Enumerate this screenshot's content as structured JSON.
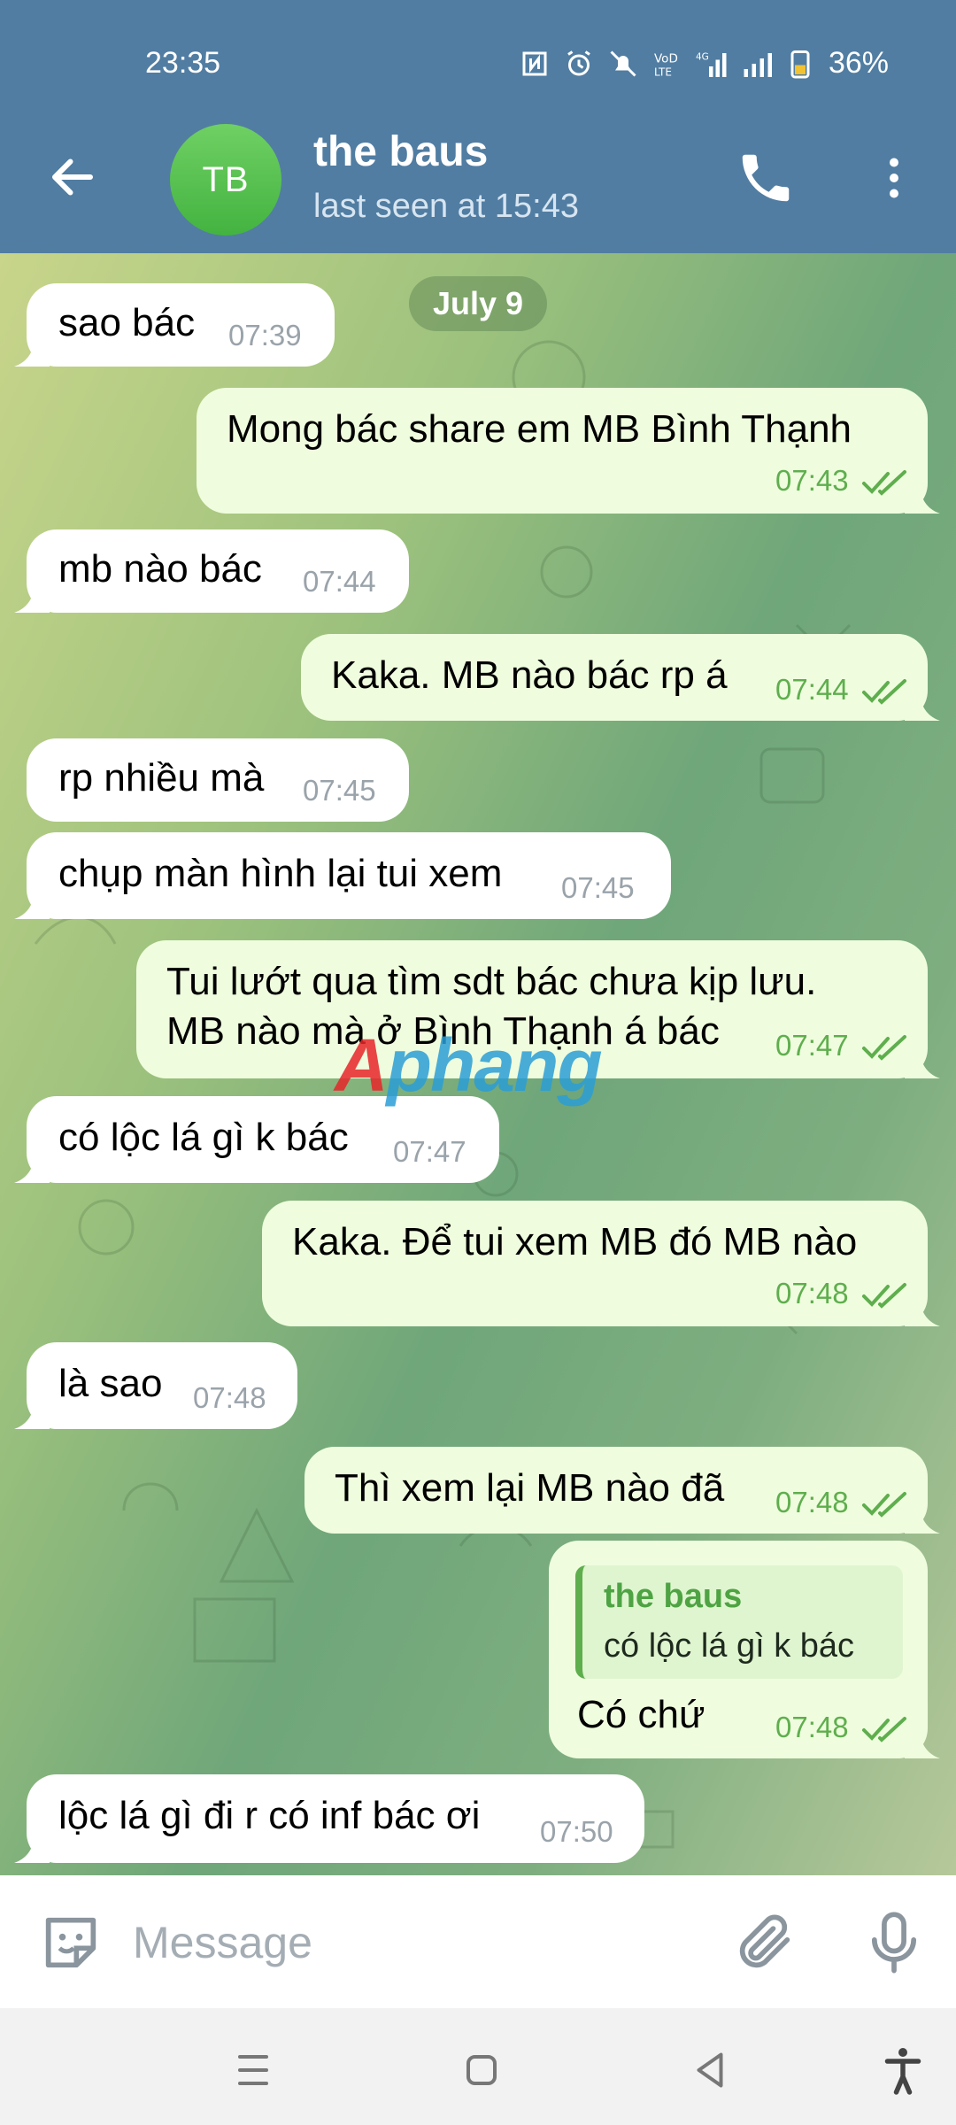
{
  "status_bar": {
    "time": "23:35",
    "battery": "36%"
  },
  "header": {
    "avatar_initials": "TB",
    "name": "the baus",
    "last_seen": "last seen at 15:43"
  },
  "date_separator": "July 9",
  "messages": [
    {
      "dir": "in",
      "text": "sao bác",
      "time": "07:39"
    },
    {
      "dir": "out",
      "text": "Mong bác share em MB Bình Thạnh",
      "time": "07:43"
    },
    {
      "dir": "in",
      "text": "mb nào bác",
      "time": "07:44"
    },
    {
      "dir": "out",
      "text": "Kaka. MB nào bác rp á",
      "time": "07:44"
    },
    {
      "dir": "in",
      "text": "rp nhiều mà",
      "time": "07:45"
    },
    {
      "dir": "in",
      "text": "chụp màn hình lại tui xem",
      "time": "07:45"
    },
    {
      "dir": "out",
      "text_line1": "Tui lướt qua tìm sdt bác chưa kịp lưu.",
      "text_line2": "MB nào mà ở Bình Thạnh á bác",
      "time": "07:47"
    },
    {
      "dir": "in",
      "text": "có lộc lá gì k bác",
      "time": "07:47"
    },
    {
      "dir": "out",
      "text": "Kaka. Để tui xem MB đó MB nào",
      "time": "07:48"
    },
    {
      "dir": "in",
      "text": "là sao",
      "time": "07:48"
    },
    {
      "dir": "out",
      "text": "Thì xem lại MB nào đã",
      "time": "07:48"
    },
    {
      "dir": "out",
      "reply_name": "the baus",
      "reply_text": "có lộc lá gì k bác",
      "text": "Có chứ",
      "time": "07:48"
    },
    {
      "dir": "in",
      "text": "lộc lá gì đi r có inf bác ơi",
      "time": "07:50"
    }
  ],
  "watermark": {
    "part1": "A",
    "part2": "phang"
  },
  "input": {
    "placeholder": "Message"
  },
  "colors": {
    "header": "#517da2",
    "outgoing_bubble": "#effdde",
    "incoming_bubble": "#ffffff",
    "tick": "#5fae4e"
  }
}
